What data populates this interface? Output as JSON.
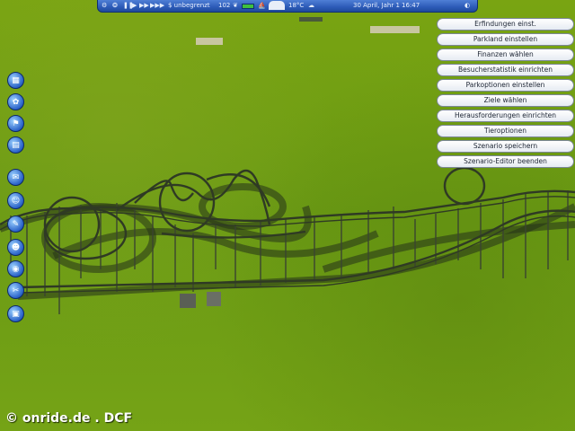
{
  "topbar": {
    "funds": "$ unbegrenzt",
    "guests": "102",
    "temperature": "18°C",
    "date": "30 April, Jahr 1",
    "time": "16:47"
  },
  "editor_menu": {
    "items": [
      {
        "label": "Erfindungen einst."
      },
      {
        "label": "Parkland einstellen"
      },
      {
        "label": "Finanzen wählen"
      },
      {
        "label": "Besucherstatistik einrichten"
      },
      {
        "label": "Parkoptionen einstellen"
      },
      {
        "label": "Ziele wählen"
      },
      {
        "label": "Herausforderungen einrichten"
      },
      {
        "label": "Tieroptionen"
      },
      {
        "label": "Szenario speichern"
      },
      {
        "label": "Szenario-Editor beenden"
      }
    ]
  },
  "left_toolbar": {
    "tools": [
      {
        "icon": "terrain-tool-icon"
      },
      {
        "icon": "scenery-tool-icon"
      },
      {
        "icon": "paths-tool-icon"
      },
      {
        "icon": "rides-tool-icon"
      },
      {
        "icon": "park-info-icon"
      },
      {
        "icon": "guests-icon"
      },
      {
        "icon": "research-icon"
      },
      {
        "icon": "staff-icon"
      },
      {
        "icon": "camera-icon"
      },
      {
        "icon": "tools-icon"
      },
      {
        "icon": "trash-icon"
      }
    ]
  },
  "watermark": "© onride.de . DCF",
  "colors": {
    "grass": "#6a9a14",
    "topbar": "#2d5bb8",
    "track": "#2f3a24"
  }
}
